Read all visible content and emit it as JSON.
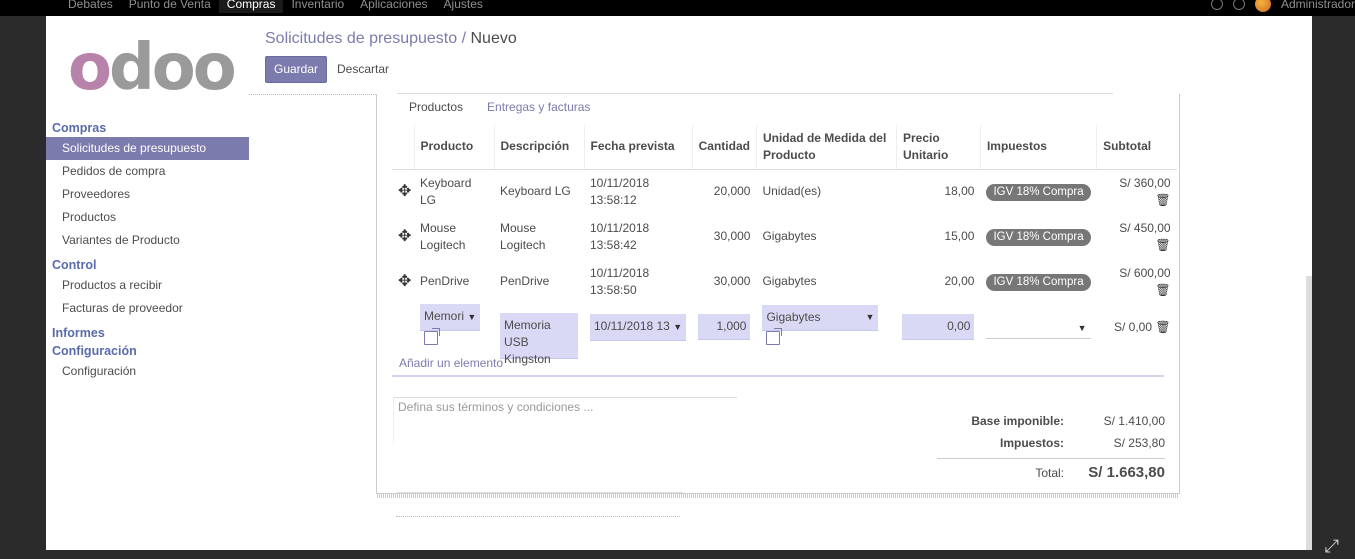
{
  "topnav": {
    "items": [
      "Debates",
      "Punto de Venta",
      "Compras",
      "Inventario",
      "Aplicaciones",
      "Ajustes"
    ],
    "active_index": 2,
    "user": "Administrador"
  },
  "brand": {
    "logo_o": "o",
    "logo_rest": "doo"
  },
  "sidebar": {
    "sections": [
      {
        "title": "Compras",
        "items": [
          "Solicitudes de presupuesto",
          "Pedidos de compra",
          "Proveedores",
          "Productos",
          "Variantes de Producto"
        ]
      },
      {
        "title": "Control",
        "items": [
          "Productos a recibir",
          "Facturas de proveedor"
        ]
      },
      {
        "title": "Informes",
        "items": []
      },
      {
        "title": "Configuración",
        "items": [
          "Configuración"
        ]
      }
    ],
    "active_item": "Solicitudes de presupuesto"
  },
  "header": {
    "breadcrumb_parent": "Solicitudes de presupuesto",
    "breadcrumb_sep": "/",
    "breadcrumb_current": "Nuevo",
    "save_label": "Guardar",
    "discard_label": "Descartar"
  },
  "tabs": {
    "products": "Productos",
    "shipments": "Entregas y facturas"
  },
  "table": {
    "headers": {
      "producto": "Producto",
      "descripcion": "Descripción",
      "fecha": "Fecha prevista",
      "cantidad": "Cantidad",
      "uom": "Unidad de Medida del Producto",
      "precio": "Precio Unitario",
      "impuestos": "Impuestos",
      "subtotal": "Subtotal"
    },
    "rows": [
      {
        "producto": "Keyboard LG",
        "descripcion": "Keyboard LG",
        "fecha": "10/11/2018 13:58:12",
        "cantidad": "20,000",
        "uom": "Unidad(es)",
        "precio": "18,00",
        "impuesto": "IGV 18% Compra",
        "subtotal": "S/ 360,00"
      },
      {
        "producto": "Mouse Logitech",
        "descripcion": "Mouse Logitech",
        "fecha": "10/11/2018 13:58:42",
        "cantidad": "30,000",
        "uom": "Gigabytes",
        "precio": "15,00",
        "impuesto": "IGV 18% Compra",
        "subtotal": "S/ 450,00"
      },
      {
        "producto": "PenDrive",
        "descripcion": "PenDrive",
        "fecha": "10/11/2018 13:58:50",
        "cantidad": "30,000",
        "uom": "Gigabytes",
        "precio": "20,00",
        "impuesto": "IGV 18% Compra",
        "subtotal": "S/ 600,00"
      }
    ],
    "edit_row": {
      "producto": "Memori",
      "descripcion": "Memoria USB Kingston",
      "fecha": "10/11/2018 13",
      "cantidad": "1,000",
      "uom": "Gigabytes",
      "precio": "0,00",
      "subtotal": "S/ 0,00"
    },
    "add_line": "Añadir un elemento"
  },
  "notes_placeholder": "Defina sus términos y condiciones ...",
  "totals": {
    "base_label": "Base imponible:",
    "base_value": "S/ 1.410,00",
    "tax_label": "Impuestos:",
    "tax_value": "S/ 253,80",
    "total_label": "Total:",
    "total_value": "S/ 1.663,80"
  },
  "icons": {
    "drag": "move-icon",
    "trash": "trash-icon",
    "external": "external-link-icon",
    "caret": "caret-down-icon"
  }
}
